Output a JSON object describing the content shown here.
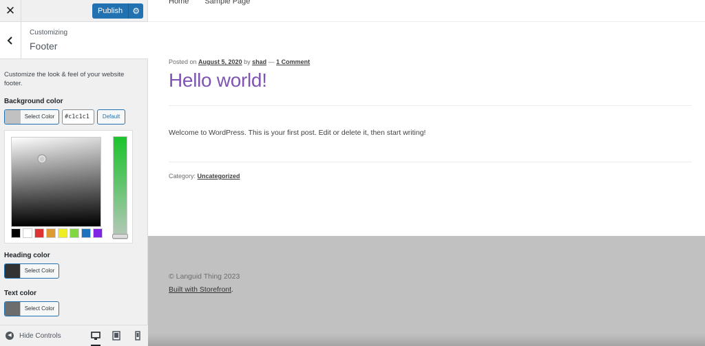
{
  "topbar": {
    "close_icon": "close-icon",
    "publish_label": "Publish",
    "gear_icon": "gear-icon"
  },
  "section": {
    "sub": "Customizing",
    "title": "Footer"
  },
  "description": "Customize the look & feel of your website footer.",
  "controls": {
    "background": {
      "label": "Background color",
      "button": "Select Color",
      "swatch": "#c1c1c1",
      "hex": "#c1c1c1",
      "default_label": "Default"
    },
    "heading": {
      "label": "Heading color",
      "button": "Select Color",
      "swatch": "#333333"
    },
    "text": {
      "label": "Text color",
      "button": "Select Color",
      "swatch": "#6d6d6d"
    }
  },
  "palette": [
    "#000000",
    "#ffffff",
    "#dd3333",
    "#dd9933",
    "#eeee22",
    "#81d742",
    "#1e73be",
    "#8224e3"
  ],
  "bottom_bar": {
    "hide_label": "Hide Controls",
    "devices": [
      "desktop-icon",
      "tablet-icon",
      "mobile-icon"
    ]
  },
  "preview": {
    "nav": [
      "Home",
      "Sample Page"
    ],
    "meta": {
      "posted_on": "Posted on",
      "date": "August 5, 2020",
      "by": "by",
      "author": "shad",
      "dash": "—",
      "comments": "1 Comment"
    },
    "post_title": "Hello world!",
    "body": "Welcome to WordPress. This is your first post. Edit or delete it, then start writing!",
    "category_label": "Category:",
    "category": "Uncategorized",
    "footer_copyright": "© Languid Thing 2023",
    "footer_built": "Built with Storefront",
    "footer_built_suffix": ".",
    "accent_color": "#7f54b3",
    "footer_bg": "#c1c1c1"
  }
}
